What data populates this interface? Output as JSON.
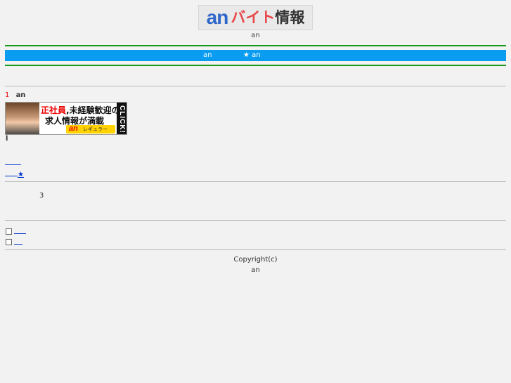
{
  "header": {
    "logo": {
      "an": "an",
      "jp_part1": "バイト",
      "jp_part2": "情報"
    },
    "subtitle": "an"
  },
  "nav": {
    "item1": "an",
    "item2": "★ an"
  },
  "section": {
    "rank_number": "1",
    "rank_label": "an",
    "banner": {
      "line1_red": "正社員",
      "line1_rest": ",未経験歓迎の",
      "line2": "求人情報が満載",
      "brand": "an",
      "tag": "レギュラー",
      "click": "CLICK!"
    },
    "small_text": "l",
    "link_star": "★"
  },
  "info": {
    "count": "3"
  },
  "footer": {
    "copyright": "Copyright(c)",
    "brand": "an"
  },
  "colors": {
    "bar": "#0a9cf0",
    "rule": "#1a9a1a",
    "link": "#0033cc"
  }
}
